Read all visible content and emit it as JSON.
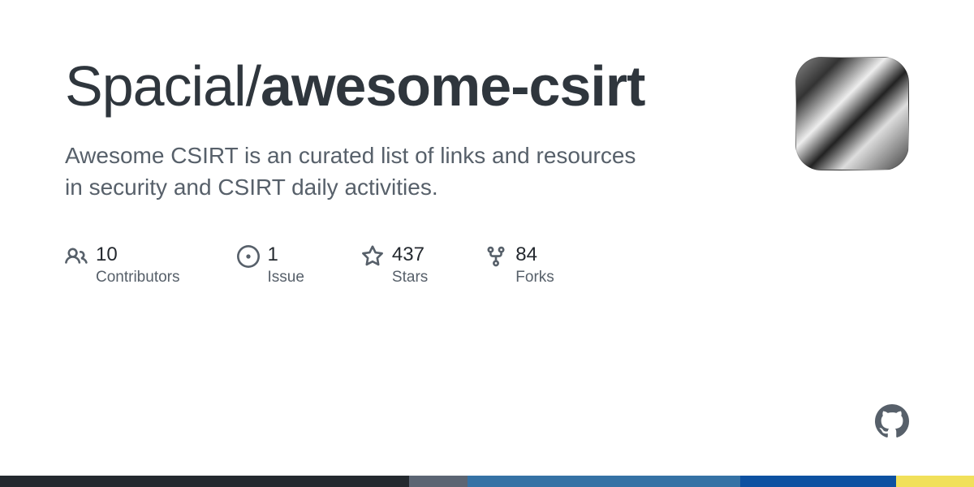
{
  "repo": {
    "owner": "Spacial",
    "slash": "/",
    "name1": "awesome",
    "hyphen": "-",
    "name2": "csirt"
  },
  "description": "Awesome CSIRT is an curated list of links and resources in security and CSIRT daily activities.",
  "stats": {
    "contributors": {
      "count": "10",
      "label": "Contributors"
    },
    "issues": {
      "count": "1",
      "label": "Issue"
    },
    "stars": {
      "count": "437",
      "label": "Stars"
    },
    "forks": {
      "count": "84",
      "label": "Forks"
    }
  },
  "languages": [
    {
      "color": "#24292f",
      "percent": 42
    },
    {
      "color": "#5b6573",
      "percent": 6
    },
    {
      "color": "#3572A5",
      "percent": 28
    },
    {
      "color": "#0d51a1",
      "percent": 16
    },
    {
      "color": "#f1e05a",
      "percent": 8
    }
  ]
}
